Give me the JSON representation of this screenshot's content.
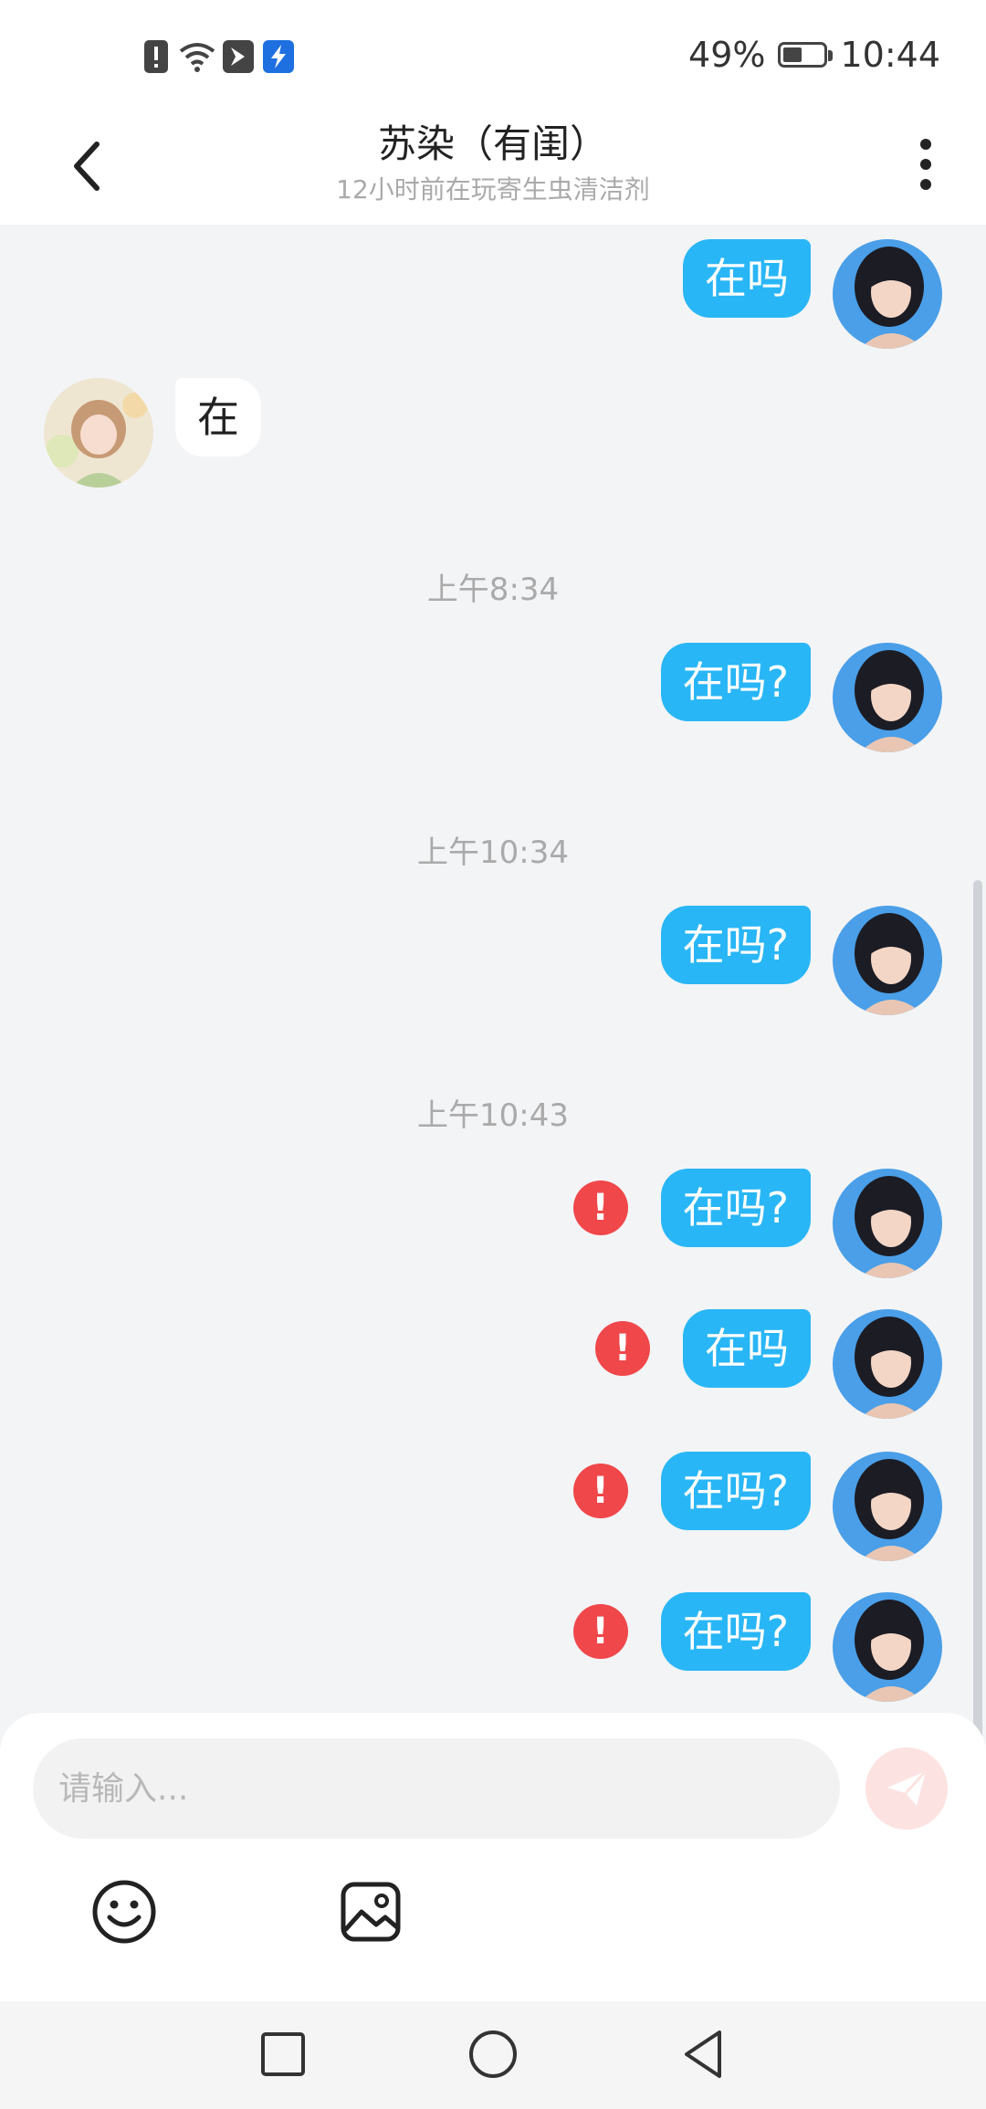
{
  "status_bar": {
    "battery_text": "49%",
    "battery_level": 0.49,
    "time": "10:44",
    "icons": [
      "alert-notification-icon",
      "wifi-icon",
      "app-notification-icon",
      "boost-app-icon"
    ]
  },
  "header": {
    "title": "苏染（有闺）",
    "subtitle": "12小时前在玩寄生虫清洁剂"
  },
  "messages": [
    {
      "direction": "out",
      "text": "在吗",
      "failed": false
    },
    {
      "direction": "in",
      "text": "在"
    },
    {
      "type": "time",
      "text": "上午8:34"
    },
    {
      "direction": "out",
      "text": "在吗?",
      "failed": false
    },
    {
      "type": "time",
      "text": "上午10:34"
    },
    {
      "direction": "out",
      "text": "在吗?",
      "failed": false
    },
    {
      "type": "time",
      "text": "上午10:43"
    },
    {
      "direction": "out",
      "text": "在吗?",
      "failed": true
    },
    {
      "direction": "out",
      "text": "在吗",
      "failed": true
    },
    {
      "direction": "out",
      "text": "在吗?",
      "failed": true
    },
    {
      "direction": "out",
      "text": "在吗?",
      "failed": true
    }
  ],
  "error_glyph": "!",
  "input": {
    "placeholder": "请输入..."
  },
  "toolbar": [
    "emoji-icon",
    "image-icon"
  ],
  "colors": {
    "outgoing_bubble": "#29b6f6",
    "incoming_bubble": "#ffffff",
    "error": "#f0474a",
    "background": "#f3f4f6"
  }
}
